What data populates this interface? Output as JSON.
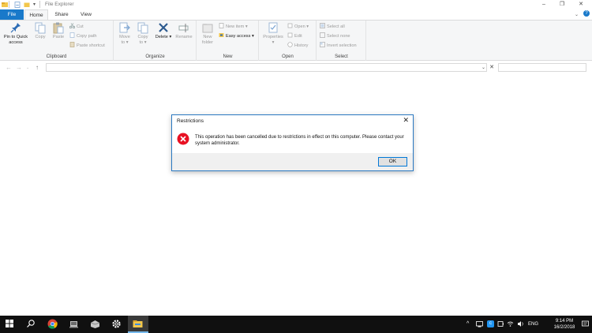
{
  "window": {
    "title": "File Explorer"
  },
  "tabs": [
    {
      "label": "File"
    },
    {
      "label": "Home"
    },
    {
      "label": "Share"
    },
    {
      "label": "View"
    }
  ],
  "ribbon": {
    "clipboard": {
      "label": "Clipboard",
      "pin_line1": "Pin to Quick",
      "pin_line2": "access",
      "copy": "Copy",
      "paste": "Paste",
      "cut": "Cut",
      "copy_path": "Copy path",
      "paste_shortcut": "Paste shortcut"
    },
    "organize": {
      "label": "Organize",
      "move_to_line1": "Move",
      "move_to_line2": "to ▾",
      "copy_to_line1": "Copy",
      "copy_to_line2": "to ▾",
      "delete": "Delete ▾",
      "rename": "Rename"
    },
    "new": {
      "label": "New",
      "new_folder_line1": "New",
      "new_folder_line2": "folder",
      "new_item": "New item ▾",
      "easy_access": "Easy access ▾"
    },
    "open": {
      "label": "Open",
      "properties": "Properties",
      "properties_arrow": "▾",
      "open": "Open ▾",
      "edit": "Edit",
      "history": "History"
    },
    "select": {
      "label": "Select",
      "select_all": "Select all",
      "select_none": "Select none",
      "invert_selection": "Invert selection"
    }
  },
  "address": {
    "value": ""
  },
  "search": {
    "value": ""
  },
  "dialog": {
    "title": "Restrictions",
    "message": "This operation has been cancelled due to restrictions in effect on this computer. Please contact your system administrator.",
    "ok_label": "OK"
  },
  "taskbar": {
    "language": "ENG",
    "time": "9:14 PM",
    "date": "16/2/2018"
  },
  "colors": {
    "accent": "#1979ca",
    "error": "#e81123",
    "taskbar": "#101010"
  }
}
